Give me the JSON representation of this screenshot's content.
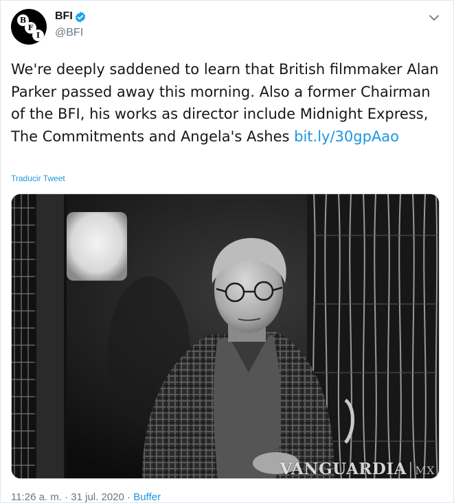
{
  "account": {
    "display_name": "BFI",
    "handle": "@BFI",
    "avatar_letters": [
      "B",
      "F",
      "I"
    ]
  },
  "tweet": {
    "text": "We're deeply saddened to learn that British filmmaker Alan Parker passed away this morning. Also a former Chairman of the BFI, his works as director include Midnight Express, The Commitments and Angela's Ashes ",
    "link": "bit.ly/30gpAao",
    "translate_label": "Traducir Tweet"
  },
  "media": {
    "watermark_main": "VANGUARDIA",
    "watermark_separator": "|",
    "watermark_suffix": "MX"
  },
  "meta": {
    "time": "11:26 a. m.",
    "dot1": " · ",
    "date": "31 jul. 2020",
    "dot2": " · ",
    "source": "Buffer"
  },
  "icons": {
    "verified": "verified-badge-icon",
    "menu": "chevron-down-icon"
  },
  "colors": {
    "link": "#1b95e0",
    "secondary_text": "#657786",
    "verified": "#1da1f2"
  }
}
